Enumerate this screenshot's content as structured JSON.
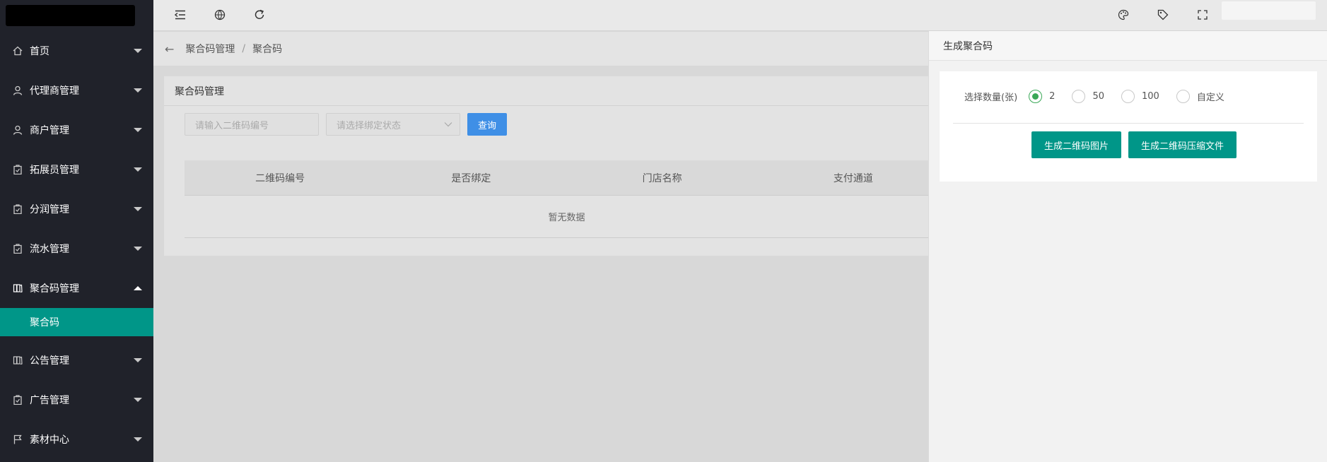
{
  "sidebar": {
    "items": [
      {
        "label": "首页",
        "icon": "home-icon"
      },
      {
        "label": "代理商管理",
        "icon": "user-icon"
      },
      {
        "label": "商户管理",
        "icon": "user-icon"
      },
      {
        "label": "拓展员管理",
        "icon": "clipboard-icon"
      },
      {
        "label": "分润管理",
        "icon": "clipboard-icon"
      },
      {
        "label": "流水管理",
        "icon": "clipboard-icon"
      },
      {
        "label": "聚合码管理",
        "icon": "book-icon"
      },
      {
        "label": "公告管理",
        "icon": "book-icon"
      },
      {
        "label": "广告管理",
        "icon": "clipboard-icon"
      },
      {
        "label": "素材中心",
        "icon": "flag-icon"
      }
    ],
    "active_sub": "聚合码"
  },
  "topbar": {
    "icons": [
      "menu-toggle-icon",
      "globe-icon",
      "refresh-icon",
      "theme-palette-icon",
      "tag-icon",
      "fullscreen-icon"
    ]
  },
  "breadcrumb": {
    "parent": "聚合码管理",
    "separator": "/",
    "current": "聚合码"
  },
  "card": {
    "title": "聚合码管理",
    "qr_placeholder": "请输入二维码编号",
    "status_placeholder": "请选择绑定状态",
    "query_button": "查询",
    "columns": [
      "二维码编号",
      "是否绑定",
      "门店名称",
      "支付通道"
    ],
    "empty_text": "暂无数据"
  },
  "drawer": {
    "title": "生成聚合码",
    "qty_label": "选择数量(张)",
    "options": [
      "2",
      "50",
      "100",
      "自定义"
    ],
    "selected": "2",
    "btn_images": "生成二维码图片",
    "btn_zip": "生成二维码压缩文件"
  },
  "colors": {
    "sidebar_bg": "#20222a",
    "accent_teal": "#009688",
    "query_blue": "#3f8fe6",
    "radio_green": "#3aa857"
  }
}
